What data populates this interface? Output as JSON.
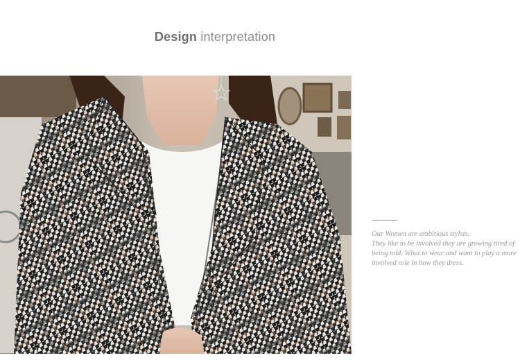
{
  "heading": {
    "bold": "Design",
    "light": " interpretation"
  },
  "caption": {
    "line1": "Our Women are ambitious stylsts.",
    "line2": "They like to be involved they are growing tired of being told. What to wear and want to play a more involved role in how they dress."
  },
  "colors": {
    "background": "#ffffff",
    "heading_text": "#777777",
    "caption_text": "#9a9a9a"
  }
}
